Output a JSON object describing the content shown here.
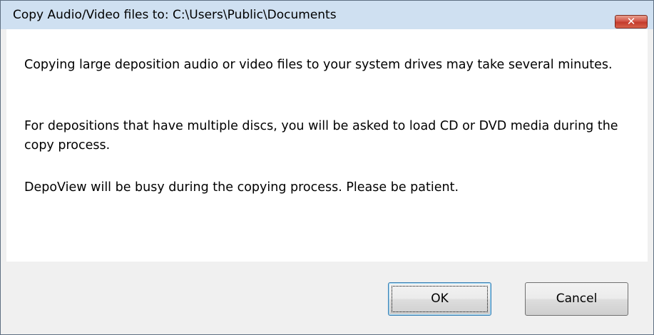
{
  "dialog": {
    "title": "Copy Audio/Video files to: C:\\Users\\Public\\Documents",
    "close_glyph": "✕",
    "messages": [
      "Copying large deposition audio or video files to your system drives may take several minutes.",
      "For depositions that have multiple discs, you will be asked to load CD or DVD media during the copy process.",
      "DepoView will be busy during the copying process.  Please be patient."
    ],
    "buttons": {
      "ok_label": "OK",
      "cancel_label": "Cancel",
      "default": "OK"
    }
  },
  "icons": {
    "close": "close-icon"
  },
  "colors": {
    "titlebar": "#cfe0f1",
    "close_button": "#c8402f",
    "content_background": "#ffffff",
    "button_area": "#f0f0f0"
  }
}
